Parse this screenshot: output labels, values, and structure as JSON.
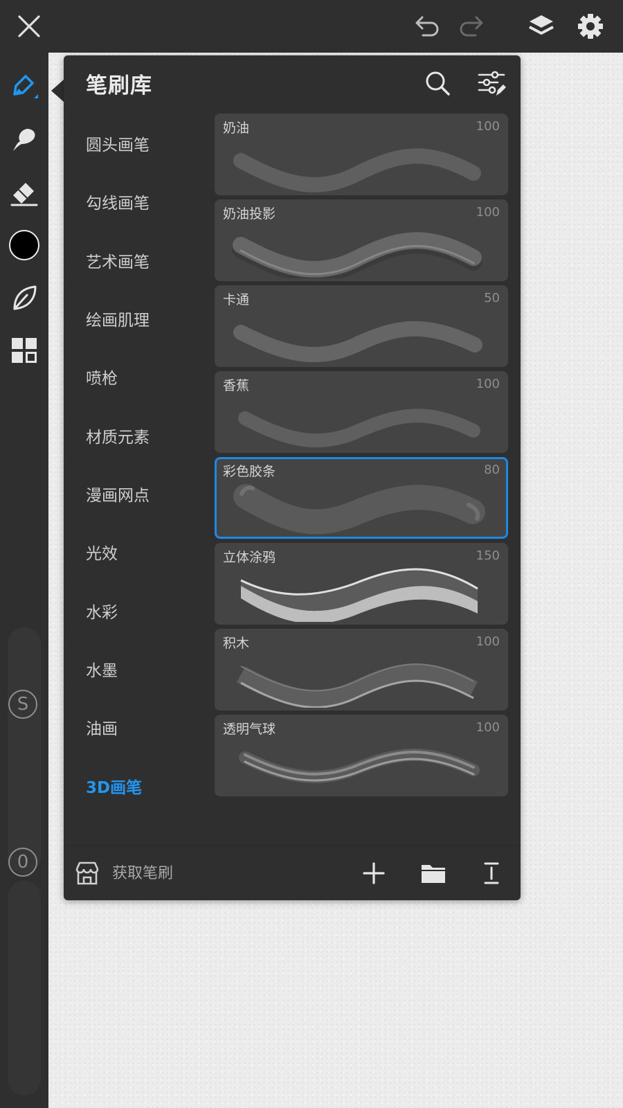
{
  "top_bar": {
    "icons": [
      "close-icon",
      "undo-icon",
      "redo-icon",
      "layers-icon",
      "settings-icon"
    ]
  },
  "left_toolbar": {
    "tools": [
      "brush-icon",
      "smudge-icon",
      "eraser-icon",
      "color-swatch",
      "leaf-icon",
      "grid-icon"
    ],
    "current_color": "#000000",
    "size_slider_label": "S",
    "opacity_slider_label": "0"
  },
  "brush_library": {
    "title": "笔刷库",
    "categories": [
      {
        "label": "圆头画笔"
      },
      {
        "label": "勾线画笔"
      },
      {
        "label": "艺术画笔"
      },
      {
        "label": "绘画肌理"
      },
      {
        "label": "喷枪"
      },
      {
        "label": "材质元素"
      },
      {
        "label": "漫画网点"
      },
      {
        "label": "光效"
      },
      {
        "label": "水彩"
      },
      {
        "label": "水墨"
      },
      {
        "label": "油画"
      },
      {
        "label": "3D画笔"
      }
    ],
    "active_category": "3D画笔",
    "brushes": [
      {
        "name": "奶油",
        "size": "100"
      },
      {
        "name": "奶油投影",
        "size": "100"
      },
      {
        "name": "卡通",
        "size": "50"
      },
      {
        "name": "香蕉",
        "size": "100"
      },
      {
        "name": "彩色胶条",
        "size": "80",
        "selected": true
      },
      {
        "name": "立体涂鸦",
        "size": "150"
      },
      {
        "name": "积木",
        "size": "100"
      },
      {
        "name": "透明气球",
        "size": "100"
      }
    ],
    "footer": {
      "get_brushes_label": "获取笔刷",
      "icons": [
        "store-icon",
        "add-icon",
        "folder-icon",
        "sort-icon"
      ]
    }
  },
  "colors": {
    "accent": "#2196f3",
    "panel_bg": "#2f2f2f",
    "card_bg": "#444444"
  }
}
